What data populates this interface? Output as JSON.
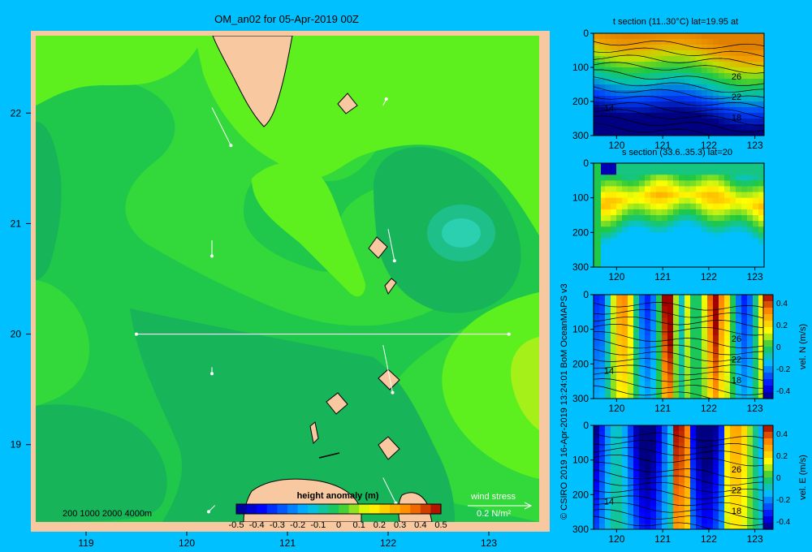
{
  "colors": {
    "background": "#00c0ff",
    "land": "#f8c8a0",
    "frame": "#f8c8a0",
    "field_levels": {
      "0.0": "#1fc84a",
      "0.05": "#33d83a",
      "0.1": "#5ef01e",
      "0.15": "#a6f01a",
      "-0.05": "#17b45a",
      "-0.1": "#1fbf8a",
      "-0.15": "#2ad0b0"
    }
  },
  "chart_data": [
    {
      "type": "heatmap",
      "title": "OM_an02 for 05-Apr-2019 00Z",
      "x_ticks": [
        "119",
        "120",
        "121",
        "122",
        "123"
      ],
      "y_ticks": [
        "22",
        "21",
        "20",
        "19"
      ],
      "xlim": [
        118.5,
        123.5
      ],
      "ylim": [
        18.3,
        22.7
      ],
      "colorbar": {
        "title": "height anomaly (m)",
        "ticks": [
          "-0.5",
          "-0.4",
          "-0.3",
          "-0.2",
          "-0.1",
          "0",
          "0.1",
          "0.2",
          "0.3",
          "0.4",
          "0.5"
        ],
        "range": [
          -0.5,
          0.5
        ]
      },
      "bathymetry_label": "200 1000 2000 4000m",
      "wind_stress_label": "wind stress",
      "wind_stress_scale": "0.2 N/m²",
      "section_line": {
        "lon": [
          119.5,
          123.2
        ],
        "lat": 20.0
      },
      "wind_vectors": [
        {
          "lon": 120.25,
          "lat": 22.05,
          "u": 0.06,
          "v": -0.12
        },
        {
          "lon": 121.95,
          "lat": 22.07,
          "u": 0.01,
          "v": 0.02
        },
        {
          "lon": 122.0,
          "lat": 20.95,
          "u": 0.02,
          "v": -0.1
        },
        {
          "lon": 120.25,
          "lat": 20.85,
          "u": 0.0,
          "v": -0.05
        },
        {
          "lon": 121.95,
          "lat": 19.9,
          "u": 0.03,
          "v": -0.15
        },
        {
          "lon": 120.25,
          "lat": 19.7,
          "u": 0.0,
          "v": -0.02
        },
        {
          "lon": 121.95,
          "lat": 18.7,
          "u": 0.04,
          "v": -0.08
        },
        {
          "lon": 120.28,
          "lat": 18.45,
          "u": -0.02,
          "v": -0.02
        }
      ]
    },
    {
      "type": "heatmap",
      "title": "t section (11..30°C) lat=19.95 at",
      "x_ticks": [
        "120",
        "121",
        "122",
        "123"
      ],
      "y_ticks": [
        "0",
        "100",
        "200",
        "300"
      ],
      "xlim": [
        119.5,
        123.2
      ],
      "ylim": [
        300,
        0
      ],
      "contour_labels": [
        "26",
        "22",
        "18",
        "14"
      ]
    },
    {
      "type": "heatmap",
      "title": "s section (33.6..35.3) lat=20",
      "x_ticks": [
        "120",
        "121",
        "122",
        "123"
      ],
      "y_ticks": [
        "0",
        "100",
        "200",
        "300"
      ],
      "xlim": [
        119.5,
        123.2
      ],
      "ylim": [
        300,
        0
      ]
    },
    {
      "type": "heatmap",
      "title": "",
      "x_ticks": [
        "120",
        "121",
        "122",
        "123"
      ],
      "y_ticks": [
        "0",
        "100",
        "200",
        "300"
      ],
      "xlim": [
        119.5,
        123.2
      ],
      "ylim": [
        300,
        0
      ],
      "contour_labels": [
        "26",
        "22",
        "18",
        "14"
      ],
      "colorbar": {
        "label": "vel. N (m/s)",
        "ticks": [
          "0.4",
          "0.2",
          "0",
          "-0.2",
          "-0.4"
        ],
        "range": [
          -0.4,
          0.4
        ]
      }
    },
    {
      "type": "heatmap",
      "title": "",
      "x_ticks": [
        "120",
        "121",
        "122",
        "123"
      ],
      "y_ticks": [
        "0",
        "100",
        "200",
        "300"
      ],
      "xlim": [
        119.5,
        123.2
      ],
      "ylim": [
        300,
        0
      ],
      "contour_labels": [
        "26",
        "22",
        "18",
        "14"
      ],
      "colorbar": {
        "label": "vel. E (m/s)",
        "ticks": [
          "0.4",
          "0.2",
          "0",
          "-0.2",
          "-0.4"
        ],
        "range": [
          -0.4,
          0.4
        ]
      }
    }
  ],
  "credit": "© CSIRO 2019   16-Apr-2019 13:24:01 BoM OceanMAPS v3"
}
